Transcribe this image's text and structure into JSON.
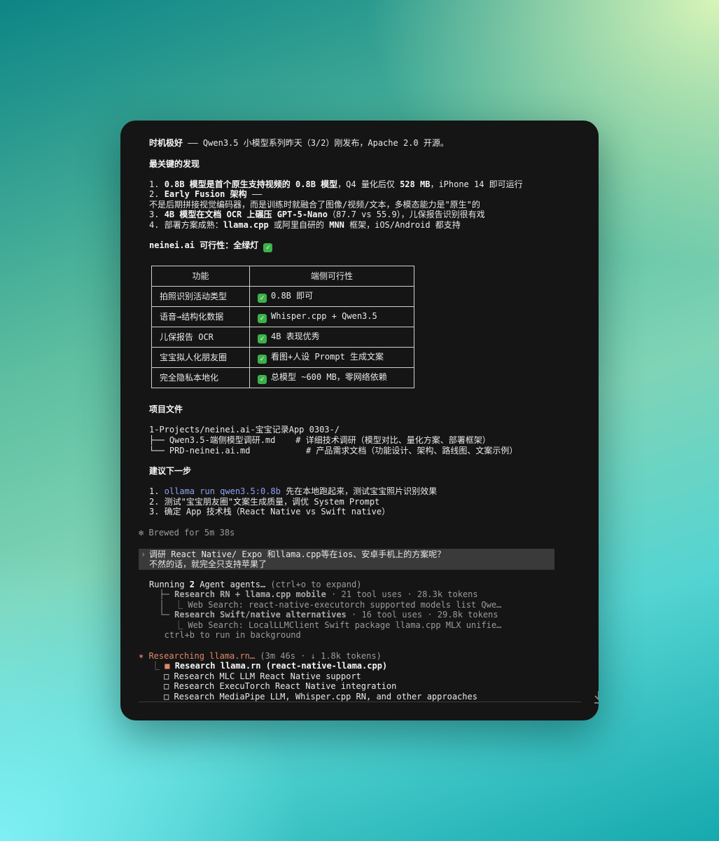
{
  "intro": {
    "lead": "时机极好",
    "rest": " —— Qwen3.5 小模型系列昨天（3/2）刚发布，Apache 2.0 开源。"
  },
  "findings": {
    "heading": "最关键的发现",
    "items": [
      {
        "num": "1. ",
        "b1": "0.8B 模型是首个原生支持视频的 0.8B 模型",
        "t1": "，Q4 量化后仅 ",
        "b2": "528 MB",
        "t2": "，iPhone 14 即可运行"
      },
      {
        "num": "2. ",
        "b1": "Early Fusion 架构",
        "t1": " —— "
      },
      {
        "cont": "不是后期拼接视觉编码器，而是训练时就融合了图像/视频/文本，多模态能力是\"原生\"的"
      },
      {
        "num": "3. ",
        "b1": "4B 模型在文档 OCR 上碾压 GPT-5-Nano",
        "t1": "（87.7 vs 55.9），儿保报告识别很有戏"
      },
      {
        "num": "4. ",
        "t0": "部署方案成熟：",
        "b1": "llama.cpp",
        "t1": " 或阿里自研的 ",
        "b2": "MNN",
        "t2": " 框架，iOS/Android 都支持"
      }
    ]
  },
  "feasibility": {
    "heading": "neinei.ai 可行性：全绿灯",
    "headers": [
      "功能",
      "端侧可行性"
    ],
    "rows": [
      [
        "拍照识别活动类型",
        "0.8B 即可"
      ],
      [
        "语音→结构化数据",
        "Whisper.cpp + Qwen3.5"
      ],
      [
        "儿保报告 OCR",
        "4B 表现优秀"
      ],
      [
        "宝宝拟人化朋友圈",
        "看图+人设 Prompt 生成文案"
      ],
      [
        "完全隐私本地化",
        "总模型 ~600 MB，零网络依赖"
      ]
    ]
  },
  "files": {
    "heading": "项目文件",
    "root": "1-Projects/neinei.ai-宝宝记录App 0303-/",
    "entries": [
      "├── Qwen3.5-端侧模型调研.md    # 详细技术调研（模型对比、量化方案、部署框架）",
      "└── PRD-neinei.ai.md           # 产品需求文档（功能设计、架构、路线图、文案示例）"
    ]
  },
  "next_steps": {
    "heading": "建议下一步",
    "step1_num": "1. ",
    "step1_cmd": "ollama run qwen3.5:0.8b",
    "step1_rest": " 先在本地跑起来，测试宝宝照片识别效果",
    "step2": "2. 测试\"宝宝朋友圈\"文案生成质量，调优 System Prompt",
    "step3": "3. 确定 App 技术栈（React Native vs Swift native）"
  },
  "brewed": "✻ Brewed for 5m 38s",
  "prompt": {
    "caret": "›",
    "line1": "调研 React Native/ Expo 和llama.cpp等在ios、安卓手机上的方案呢？",
    "line2": "不然的话，就完全只支持苹果了"
  },
  "agents": {
    "running_pre": "Running ",
    "running_count": "2",
    "running_post": " Agent agents…",
    "running_hint": " (ctrl+o to expand)",
    "agent1_prefix": "  ├─ ",
    "agent1_name": "Research RN + llama.cpp mobile",
    "agent1_stats": " · 21 tool uses · 28.3k tokens",
    "agent1_sub": "  │  ⎿ Web Search: react-native-executorch supported models list Qwe…",
    "agent2_prefix": "  └─ ",
    "agent2_name": "Research Swift/native alternatives",
    "agent2_stats": " · 16 tool uses · 29.8k tokens",
    "agent2_sub": "     ⎿ Web Search: LocalLLMClient Swift package llama.cpp MLX unifie…",
    "bg_hint": "   ctrl+b to run in background"
  },
  "researching": {
    "star": "✶ ",
    "label": "Researching llama.rn…",
    "stats": " (3m 46s · ↓ 1.8k tokens)",
    "tasks": [
      {
        "mark": "■",
        "text": "Research llama.rn (react-native-llama.cpp)",
        "active": true
      },
      {
        "mark": "□",
        "text": "Research MLC LLM React Native support",
        "active": false
      },
      {
        "mark": "□",
        "text": "Research ExecuTorch React Native integration",
        "active": false
      },
      {
        "mark": "□",
        "text": "Research MediaPipe LLM, Whisper.cpp RN, and other approaches",
        "active": false
      }
    ]
  },
  "icons": {
    "check": "check-icon",
    "scroll": "scroll-down-icon"
  }
}
